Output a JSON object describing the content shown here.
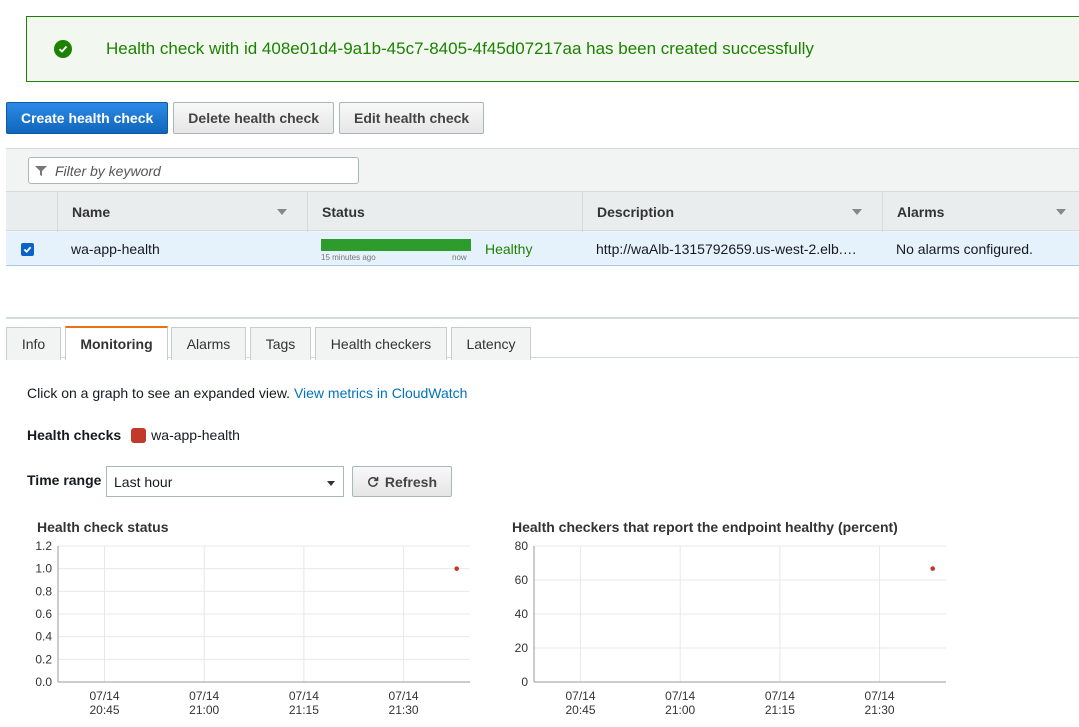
{
  "flash": {
    "message": "Health check with id 408e01d4-9a1b-45c7-8405-4f45d07217aa has been created successfully"
  },
  "toolbar": {
    "create": "Create health check",
    "delete": "Delete health check",
    "edit": "Edit health check"
  },
  "filter": {
    "placeholder": "Filter by keyword"
  },
  "table": {
    "headers": [
      "Name",
      "Status",
      "Description",
      "Alarms"
    ],
    "row": {
      "name": "wa-app-health",
      "status": "Healthy",
      "bar_left": "15 minutes ago",
      "bar_right": "now",
      "healthy_fraction": 1.0,
      "description": "http://waAlb-1315792659.us-west-2.elb.…",
      "alarms": "No alarms configured."
    }
  },
  "tabs": [
    "Info",
    "Monitoring",
    "Alarms",
    "Tags",
    "Health checkers",
    "Latency"
  ],
  "active_tab": "Monitoring",
  "monitoring": {
    "hint": "Click on a graph to see an expanded view.",
    "link": "View metrics in CloudWatch",
    "hc_label": "Health checks",
    "hc_name": "wa-app-health",
    "time_label": "Time range",
    "time_value": "Last hour",
    "refresh": "Refresh"
  },
  "chart_data": [
    {
      "type": "scatter",
      "title": "Health check status",
      "ylim": [
        0,
        1.2
      ],
      "yticks": [
        "1.2",
        "1.0",
        "0.8",
        "0.6",
        "0.4",
        "0.2",
        "0.0"
      ],
      "xticks": [
        [
          "07/14",
          "20:45"
        ],
        [
          "07/14",
          "21:00"
        ],
        [
          "07/14",
          "21:15"
        ],
        [
          "07/14",
          "21:30"
        ]
      ],
      "x": [
        "21:38"
      ],
      "values": [
        1.0
      ],
      "color": "#c0392b"
    },
    {
      "type": "scatter",
      "title": "Health checkers that report the endpoint healthy (percent)",
      "ylim": [
        0,
        80
      ],
      "yticks": [
        "80",
        "60",
        "40",
        "20",
        "0"
      ],
      "xticks": [
        [
          "07/14",
          "20:45"
        ],
        [
          "07/14",
          "21:00"
        ],
        [
          "07/14",
          "21:15"
        ],
        [
          "07/14",
          "21:30"
        ]
      ],
      "x": [
        "21:38"
      ],
      "values": [
        66.7
      ],
      "color": "#c0392b"
    }
  ]
}
